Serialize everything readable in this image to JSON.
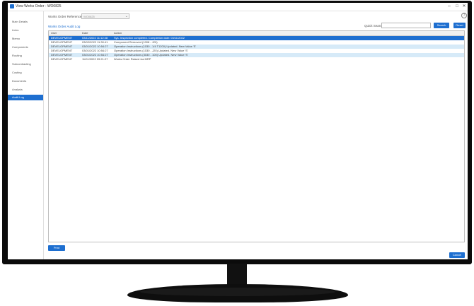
{
  "window": {
    "title": "View Works Order - WO0825",
    "minimize_glyph": "–",
    "maximize_glyph": "□",
    "close_glyph": "✕",
    "help_glyph": "?"
  },
  "sidebar": {
    "items": [
      {
        "label": "Main Details"
      },
      {
        "label": "Links"
      },
      {
        "label": "Memo"
      },
      {
        "label": "Components"
      },
      {
        "label": "Routing"
      },
      {
        "label": "Subcontracting"
      },
      {
        "label": "Costing"
      },
      {
        "label": "Documents"
      },
      {
        "label": "Analysis"
      },
      {
        "label": "Audit Log"
      }
    ],
    "active_index": 9
  },
  "works_order": {
    "label": "Works Order Reference",
    "value": "WO0825"
  },
  "audit": {
    "section_title": "Works Order Audit Log",
    "quick_search_label": "Quick Search",
    "quick_search_value": "",
    "search_button": "Search",
    "reset_button": "Reset",
    "columns": [
      "User",
      "Date",
      "Action"
    ],
    "rows": [
      {
        "user": "DEVELOPMENT",
        "date": "03/11/2022 11:12:48",
        "action": "Sys. Inspection completed. Completion date: 03/11/2022"
      },
      {
        "user": "DEVELOPMENT",
        "date": "03/02/2022 11:30:41",
        "action": "Component Removed (1008 - J20)"
      },
      {
        "user": "DEVELOPMENT",
        "date": "03/01/2022 10:54:27",
        "action": "Operation Instructions (1030 - 1/4 T1200) Updated. New Value 'S'"
      },
      {
        "user": "DEVELOPMENT",
        "date": "03/01/2022 10:54:27",
        "action": "Operation Instructions (1030 - J20) Updated. New Value 'S'"
      },
      {
        "user": "DEVELOPMENT",
        "date": "03/01/2022 10:54:27",
        "action": "Operation Instructions (3030 - 100) Updated. New Value 'S'"
      },
      {
        "user": "DEVELOPMENT",
        "date": "11/01/2022 09:21:27",
        "action": "Works Order Raised via MRP"
      }
    ],
    "selected_row": 0
  },
  "footer": {
    "print_button": "Print",
    "cancel_button": "Cancel"
  },
  "colors": {
    "accent": "#1e6fd0",
    "row_alt": "#d6eaf8",
    "bezel": "#0b0b0b"
  }
}
